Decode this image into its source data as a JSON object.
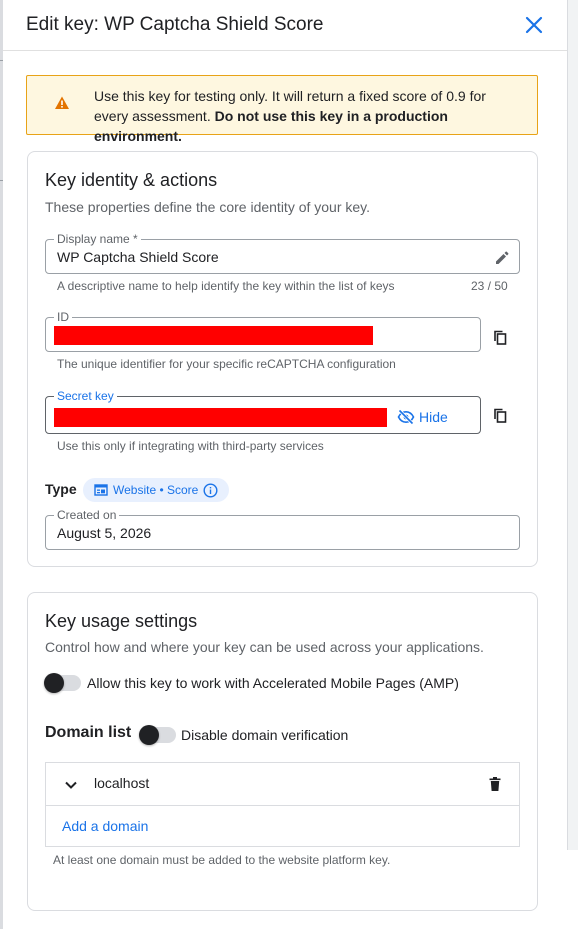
{
  "header": {
    "title": "Edit key: WP Captcha Shield Score",
    "close_icon": "close-icon"
  },
  "warning": {
    "text": "Use this key for testing only. It will return a fixed score of 0.9 for every assessment.",
    "bold_text": "Do not use this key in a production environment.",
    "icon": "warning-icon",
    "color": "#e37400"
  },
  "identity": {
    "title": "Key identity & actions",
    "subtitle": "These properties define the core identity of your key.",
    "display_name": {
      "label": "Display name *",
      "value": "WP Captcha Shield Score",
      "hint": "A descriptive name to help identify the key within the list of keys",
      "counter": "23 / 50"
    },
    "id_field": {
      "label": "ID",
      "hint": "The unique identifier for your specific reCAPTCHA configuration"
    },
    "secret_key": {
      "label": "Secret key",
      "hide_label": "Hide",
      "hint": "Use this only if integrating with third-party services"
    },
    "type": {
      "label": "Type",
      "chip": "Website • Score"
    },
    "created_on": {
      "label": "Created on",
      "value": "August 5, 2026"
    }
  },
  "usage": {
    "title": "Key usage settings",
    "subtitle": "Control how and where your key can be used across your applications.",
    "amp_label": "Allow this key to work with Accelerated Mobile Pages (AMP)",
    "domain_list_label": "Domain list",
    "disable_verification_label": "Disable domain verification",
    "domains": [
      "localhost"
    ],
    "add_domain": "Add a domain",
    "footer_hint": "At least one domain must be added to the website platform key."
  },
  "colors": {
    "accent": "#1a73e8",
    "redaction": "#ff0000",
    "warning_bg": "#fef7e0",
    "warning_border": "#e8a317"
  }
}
